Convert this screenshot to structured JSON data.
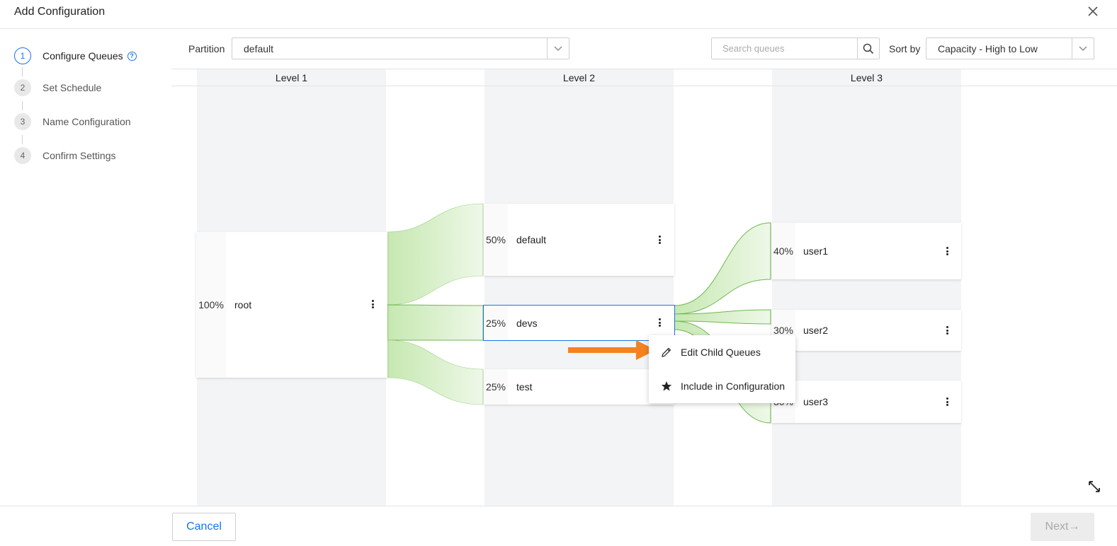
{
  "dialog": {
    "title": "Add Configuration"
  },
  "steps": [
    {
      "num": "1",
      "label": "Configure Queues",
      "active": true
    },
    {
      "num": "2",
      "label": "Set Schedule"
    },
    {
      "num": "3",
      "label": "Name Configuration"
    },
    {
      "num": "4",
      "label": "Confirm Settings"
    }
  ],
  "help_glyph": "?",
  "toolbar": {
    "partition_label": "Partition",
    "partition_value": "default",
    "search_placeholder": "Search queues",
    "sort_label": "Sort by",
    "sort_value": "Capacity - High to Low"
  },
  "levels": [
    "Level 1",
    "Level 2",
    "Level 3"
  ],
  "queues": {
    "root": {
      "pct": "100%",
      "name": "root"
    },
    "default": {
      "pct": "50%",
      "name": "default"
    },
    "devs": {
      "pct": "25%",
      "name": "devs"
    },
    "test": {
      "pct": "25%",
      "name": "test"
    },
    "user1": {
      "pct": "40%",
      "name": "user1"
    },
    "user2": {
      "pct": "30%",
      "name": "user2"
    },
    "user3": {
      "pct": "30%",
      "name": "user3"
    }
  },
  "context_menu": {
    "edit": "Edit Child Queues",
    "include": "Include in Configuration"
  },
  "colors": {
    "accent": "#1a73e8",
    "flow_fill": "#d8f0c8",
    "flow_stroke": "#7cc25c",
    "annotation": "#f5821f"
  },
  "footer": {
    "cancel": "Cancel",
    "next": "Next→"
  }
}
